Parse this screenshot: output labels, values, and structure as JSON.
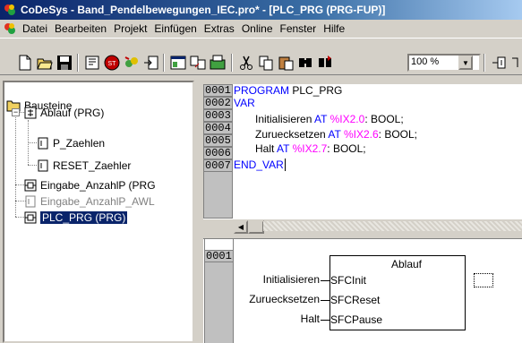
{
  "window": {
    "title": "CoDeSys - Band_Pendelbewegungen_IEC.pro* - [PLC_PRG (PRG-FUP)]"
  },
  "menu": {
    "items": [
      "Datei",
      "Bearbeiten",
      "Projekt",
      "Einfügen",
      "Extras",
      "Online",
      "Fenster",
      "Hilfe"
    ]
  },
  "toolbar": {
    "zoom_value": "100 %",
    "icons": [
      "new-file-icon",
      "open-folder-icon",
      "save-icon",
      "build-icon",
      "stop-icon",
      "login-icon",
      "logout-icon",
      "window-icon",
      "compare-icon",
      "replace-icon",
      "cut-icon",
      "copy-icon",
      "paste-icon",
      "find-icon",
      "find-next-icon",
      "insert-box-icon"
    ]
  },
  "tree": {
    "root_label": "Bausteine",
    "items": [
      {
        "label": "Ablauf (PRG)",
        "state": "normal"
      },
      {
        "label": "P_Zaehlen",
        "state": "normal"
      },
      {
        "label": "RESET_Zaehler",
        "state": "normal"
      },
      {
        "label": "Eingabe_AnzahlP (PRG",
        "state": "normal"
      },
      {
        "label": "Eingabe_AnzahlP_AWL",
        "state": "grayed"
      },
      {
        "label": "PLC_PRG (PRG)",
        "state": "selected"
      }
    ]
  },
  "declaration": {
    "lines": [
      {
        "num": "0001",
        "kw": "PROGRAM",
        "text": " PLC_PRG"
      },
      {
        "num": "0002",
        "kw": "VAR",
        "text": ""
      },
      {
        "num": "0003",
        "var": "Initialisieren",
        "at": "AT",
        "addr": "%IX2.0",
        "type": ": BOOL;"
      },
      {
        "num": "0004",
        "var": "Zuruecksetzen",
        "at": "AT",
        "addr": "%IX2.6",
        "type": ": BOOL;"
      },
      {
        "num": "0005",
        "var": "Halt",
        "at": "AT",
        "addr": "%IX2.7",
        "type": ": BOOL;"
      },
      {
        "num": "0006",
        "kw": "END_VAR",
        "text": ""
      },
      {
        "num": "0007",
        "kw": "",
        "text": ""
      }
    ]
  },
  "fup": {
    "network_num": "0001",
    "block_name": "Ablauf",
    "inputs": [
      {
        "signal": "Initialisieren",
        "pin": "SFCInit"
      },
      {
        "signal": "Zuruecksetzen",
        "pin": "SFCReset"
      },
      {
        "signal": "Halt",
        "pin": "SFCPause"
      }
    ]
  }
}
